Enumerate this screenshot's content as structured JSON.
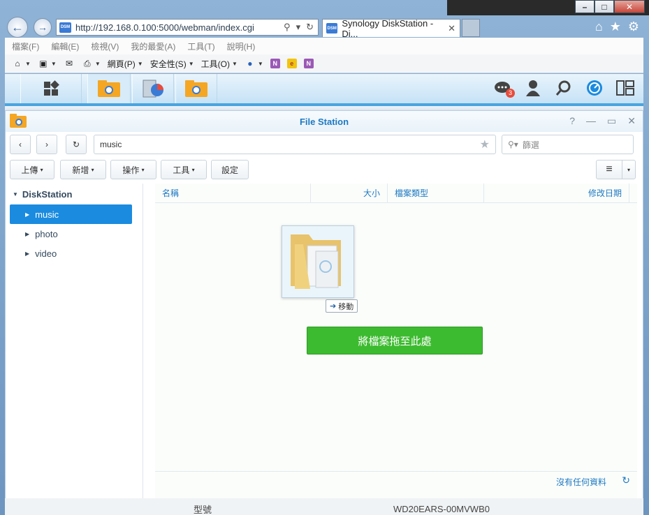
{
  "browser": {
    "address": "http://192.168.0.100:5000/webman/index.cgi",
    "tab_title": "Synology DiskStation - Di...",
    "tab_badge": "DSM",
    "window_controls": [
      "minimize",
      "maximize",
      "close"
    ],
    "menu": [
      "檔案(F)",
      "編輯(E)",
      "檢視(V)",
      "我的最愛(A)",
      "工具(T)",
      "說明(H)"
    ],
    "commands": {
      "page_label": "網頁(P)",
      "safety_label": "安全性(S)",
      "tools_label": "工具(O)"
    }
  },
  "taskbar": {
    "notification_count": "3",
    "accent": "#49a4e0"
  },
  "file_station": {
    "title": "File Station",
    "path": "music",
    "filter_placeholder": "篩選",
    "toolbar": {
      "upload_label": "上傳",
      "create_label": "新增",
      "action_label": "操作",
      "tools_label": "工具",
      "settings_label": "設定"
    },
    "tree": {
      "root": "DiskStation",
      "items": [
        "music",
        "photo",
        "video"
      ],
      "selected": "music"
    },
    "columns": [
      "名稱",
      "大小",
      "檔案類型",
      "修改日期"
    ],
    "drag_tag": "移動",
    "drop_label": "將檔案拖至此處",
    "status": "沒有任何資料",
    "accent": "#1b8be0",
    "drop_color": "#3dbb30"
  },
  "peek": {
    "left": "型號",
    "right": "WD20EARS-00MVWB0"
  }
}
